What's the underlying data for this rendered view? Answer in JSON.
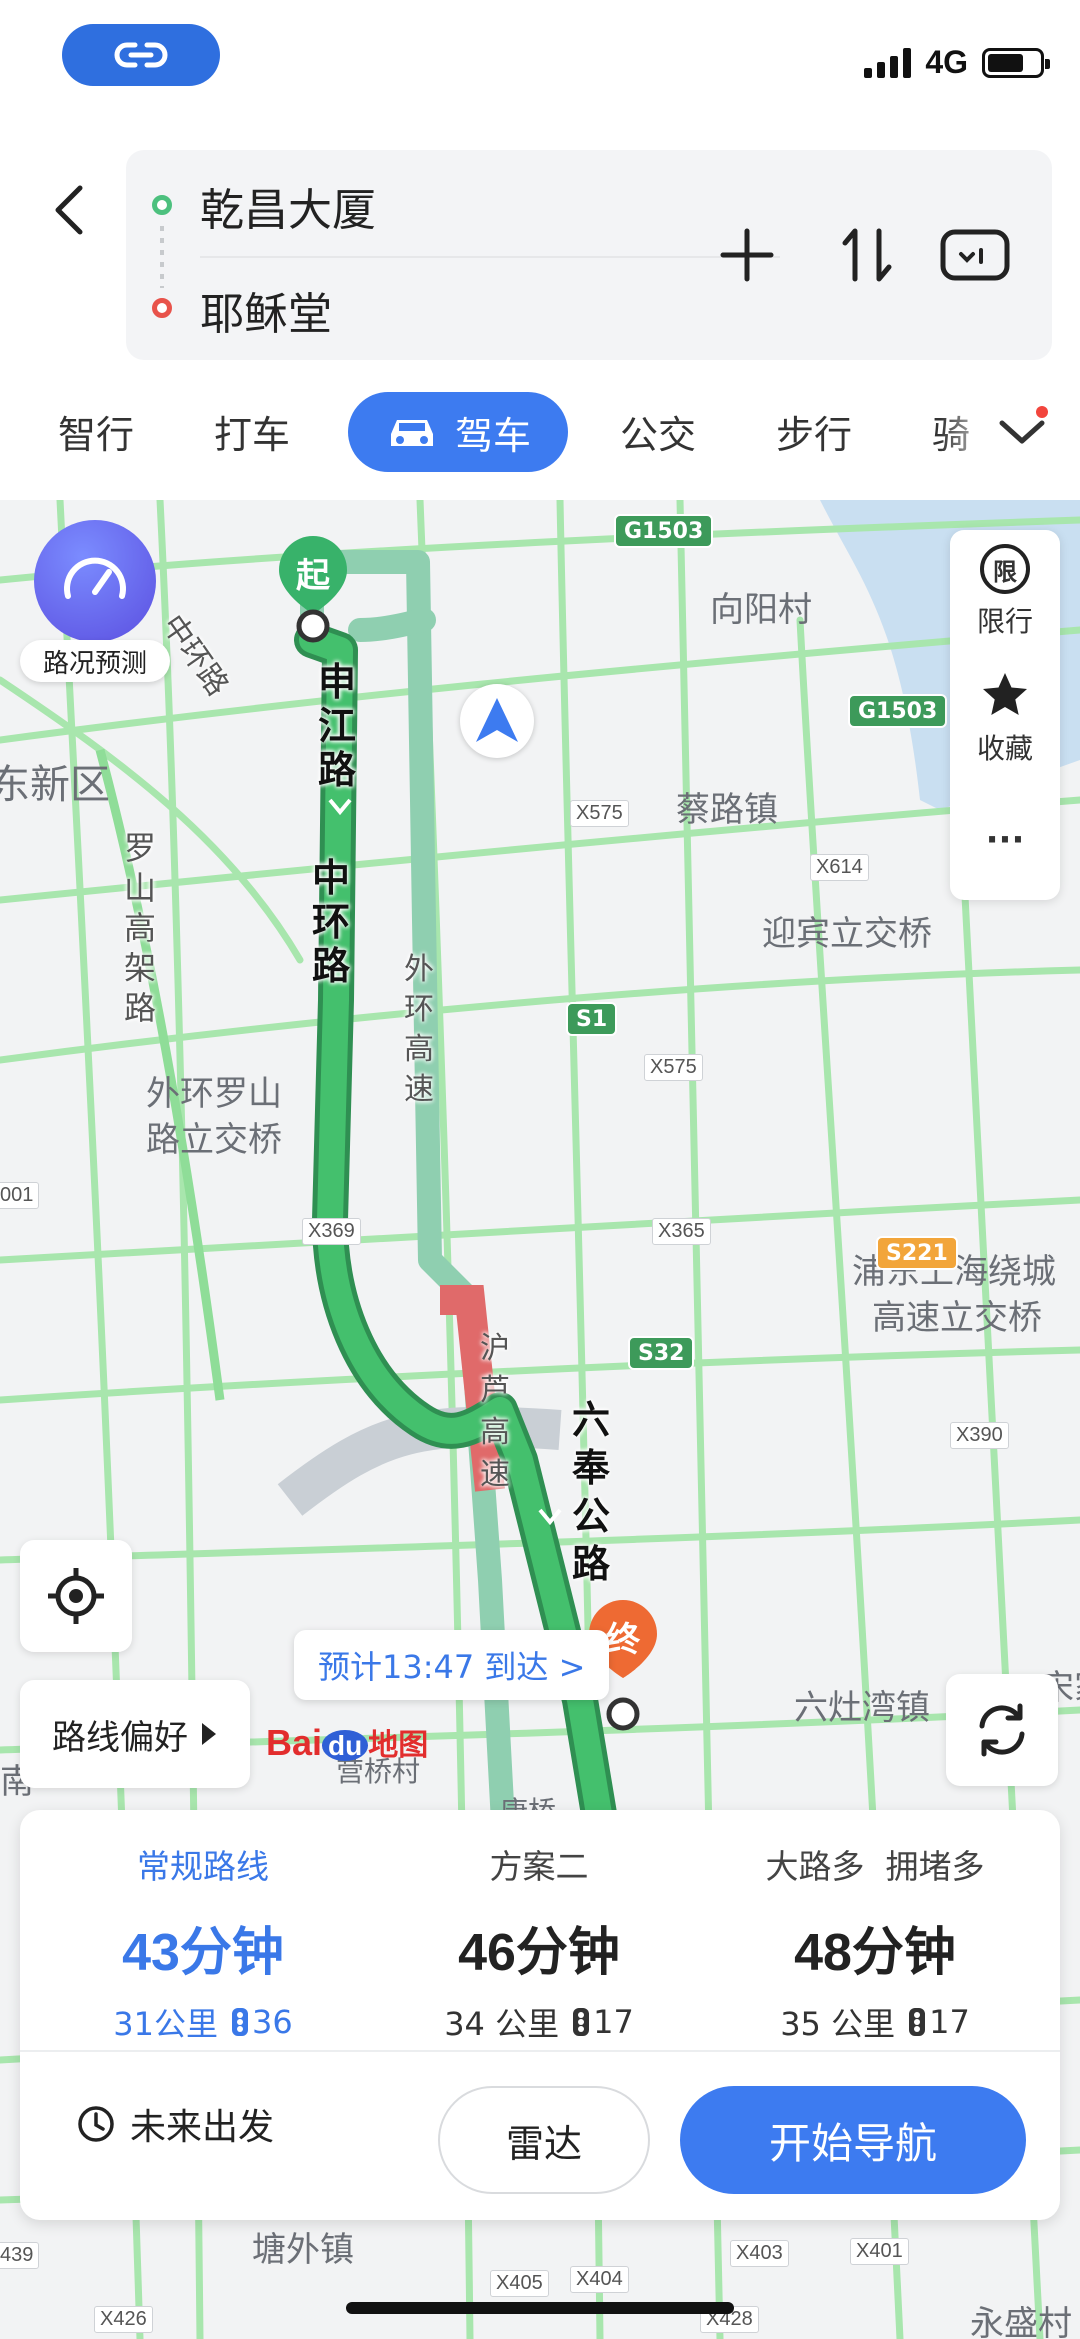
{
  "status": {
    "network": "4G",
    "battery_level": 0.7
  },
  "header": {
    "origin": "乾昌大厦",
    "destination": "耶稣堂"
  },
  "modes": {
    "items": [
      "智行",
      "打车",
      "驾车",
      "公交",
      "步行",
      "骑"
    ],
    "active": "驾车"
  },
  "map": {
    "speed_label": "路况预测",
    "side_panel": {
      "restrict": "限行",
      "restrict_icon_text": "限",
      "favorite": "收藏",
      "more": "···"
    },
    "start_marker": "起",
    "end_marker": "终",
    "eta": "预计13:47 到达 >",
    "route_pref": "路线偏好",
    "logo_bai": "Bai",
    "logo_du": "du",
    "logo_map": "地图",
    "places": {
      "xiangyang": "向阳村",
      "cailu": "蔡路镇",
      "yingbin": "迎宾立交桥",
      "xinqu": "东新区",
      "waihuan_luoshan_1": "外环罗山",
      "waihuan_luoshan_2": "路立交桥",
      "pudong_1": "浦东上海绕城",
      "pudong_2": "高速立交桥",
      "liuzao": "六灶湾镇",
      "tangwai": "塘外镇",
      "yongsheng": "永盛村",
      "nan": "南",
      "kangqiao": "康桥",
      "shengqiao": "营桥村",
      "song": "宋家"
    },
    "roads": {
      "shenjiang": "申江路",
      "zhonghuan": "中环路",
      "zhonghuan2": "中环路",
      "luoshan": "罗山高架路",
      "waihuan": "外环高速",
      "hulu": "沪芦高速",
      "liufeng": "六奉公路"
    },
    "shields": {
      "g1503_top": "G1503",
      "g1503_mid": "G1503",
      "s1_right": "S1",
      "s1": "S1",
      "s221": "S221",
      "s32": "S32"
    },
    "codes": {
      "x575a": "X575",
      "x614": "X614",
      "x575b": "X575",
      "x369": "X369",
      "x365": "X365",
      "x390": "X390",
      "x405": "X405",
      "x404": "X404",
      "x403": "X403",
      "x401": "X401",
      "x426": "X426",
      "x428": "X428",
      "x439": "439",
      "x001": "001"
    }
  },
  "plans": [
    {
      "tag": "常规路线",
      "time": "43分钟",
      "distance": "31公里",
      "lights": "36",
      "selected": true
    },
    {
      "tag": "方案二",
      "time": "46分钟",
      "distance": "34 公里",
      "lights": "17",
      "selected": false
    },
    {
      "tag": "大路多  拥堵多",
      "time": "48分钟",
      "distance": "35 公里",
      "lights": "17",
      "selected": false
    }
  ],
  "actions": {
    "future": "未来出发",
    "radar": "雷达",
    "navigate": "开始导航"
  },
  "colors": {
    "accent": "#3d7bf0",
    "route_main": "#3fb865",
    "route_alt": "#8fcfb0",
    "congestion": "#e06a6a",
    "map_road": "#9ee3a4"
  }
}
